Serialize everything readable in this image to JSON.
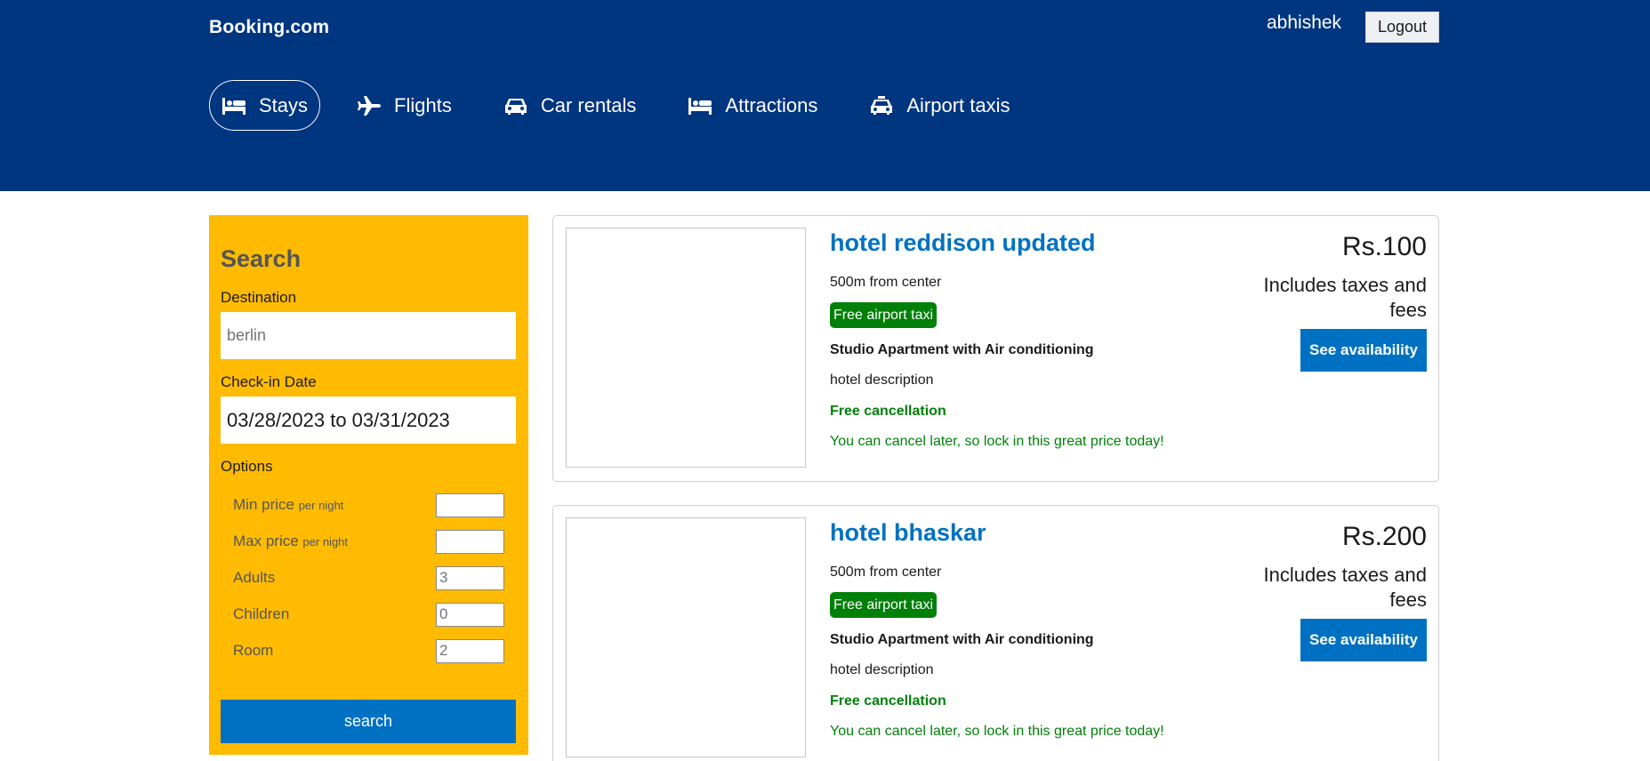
{
  "header": {
    "brand": "Booking.com",
    "username": "abhishek",
    "logout_label": "Logout",
    "nav": [
      {
        "label": "Stays",
        "icon": "bed-icon",
        "active": true
      },
      {
        "label": "Flights",
        "icon": "plane-icon",
        "active": false
      },
      {
        "label": "Car rentals",
        "icon": "car-icon",
        "active": false
      },
      {
        "label": "Attractions",
        "icon": "bed-icon",
        "active": false
      },
      {
        "label": "Airport taxis",
        "icon": "taxi-icon",
        "active": false
      }
    ]
  },
  "search": {
    "title": "Search",
    "destination_label": "Destination",
    "destination_value": "berlin",
    "checkin_label": "Check-in Date",
    "date_range": "03/28/2023 to 03/31/2023",
    "options_label": "Options",
    "min_price_label": "Min price",
    "max_price_label": "Max price",
    "per_night": "per night",
    "min_price_value": "",
    "max_price_value": "",
    "adults_label": "Adults",
    "adults_value": "3",
    "children_label": "Children",
    "children_value": "0",
    "room_label": "Room",
    "room_value": "2",
    "search_button": "search"
  },
  "hotels": [
    {
      "name": "hotel reddison updated",
      "distance": "500m from center",
      "taxi_badge": "Free airport taxi",
      "room_type": "Studio Apartment with Air conditioning",
      "description": "hotel description",
      "cancellation": "Free cancellation",
      "cancel_note": "You can cancel later, so lock in this great price today!",
      "price": "Rs.100",
      "tax_note": "Includes taxes and fees",
      "availability_button": "See availability"
    },
    {
      "name": "hotel bhaskar",
      "distance": "500m from center",
      "taxi_badge": "Free airport taxi",
      "room_type": "Studio Apartment with Air conditioning",
      "description": "hotel description",
      "cancellation": "Free cancellation",
      "cancel_note": "You can cancel later, so lock in this great price today!",
      "price": "Rs.200",
      "tax_note": "Includes taxes and fees",
      "availability_button": "See availability"
    }
  ],
  "colors": {
    "header_bg": "#003580",
    "sidebar_bg": "#febb02",
    "accent_blue": "#0071c2",
    "green": "#008009"
  }
}
